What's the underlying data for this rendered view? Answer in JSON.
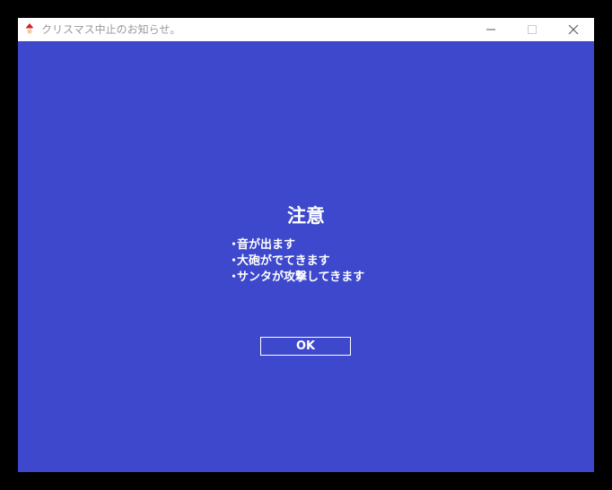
{
  "window": {
    "title": "クリスマス中止のお知らせ。",
    "app_icon": "santa-icon",
    "controls": {
      "minimize_icon": "minimize-icon",
      "maximize_icon": "maximize-icon",
      "close_icon": "close-icon"
    }
  },
  "dialog": {
    "heading": "注意",
    "bullet": "・",
    "notes": [
      "音が出ます",
      "大砲がでてきます",
      "サンタが攻撃してきます"
    ],
    "ok_label": "OK"
  },
  "colors": {
    "background": "#3d48cc",
    "titlebar": "#ffffff",
    "text": "#ffffff",
    "frame": "#000000"
  }
}
